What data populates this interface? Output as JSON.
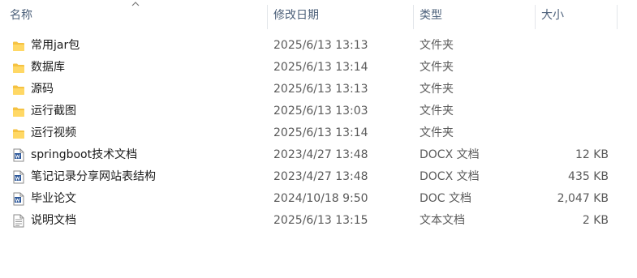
{
  "columns": {
    "name": "名称",
    "date": "修改日期",
    "type": "类型",
    "size": "大小"
  },
  "colors": {
    "header_text": "#4c607a",
    "folder": "#f5c242",
    "word_icon": "#2b579a"
  },
  "files": [
    {
      "name": "常用jar包",
      "date": "2025/6/13 13:13",
      "type": "文件夹",
      "size": "",
      "icon": "folder-icon"
    },
    {
      "name": "数据库",
      "date": "2025/6/13 13:14",
      "type": "文件夹",
      "size": "",
      "icon": "folder-icon"
    },
    {
      "name": "源码",
      "date": "2025/6/13 13:13",
      "type": "文件夹",
      "size": "",
      "icon": "folder-icon"
    },
    {
      "name": "运行截图",
      "date": "2025/6/13 13:03",
      "type": "文件夹",
      "size": "",
      "icon": "folder-icon"
    },
    {
      "name": "运行视频",
      "date": "2025/6/13 13:14",
      "type": "文件夹",
      "size": "",
      "icon": "folder-icon"
    },
    {
      "name": "springboot技术文档",
      "date": "2023/4/27 13:48",
      "type": "DOCX 文档",
      "size": "12 KB",
      "icon": "word-doc-icon"
    },
    {
      "name": "笔记记录分享网站表结构",
      "date": "2023/4/27 13:48",
      "type": "DOCX 文档",
      "size": "435 KB",
      "icon": "word-doc-icon"
    },
    {
      "name": "毕业论文",
      "date": "2024/10/18 9:50",
      "type": "DOC 文档",
      "size": "2,047 KB",
      "icon": "word-doc-icon"
    },
    {
      "name": "说明文档",
      "date": "2025/6/13 13:15",
      "type": "文本文档",
      "size": "2 KB",
      "icon": "text-doc-icon"
    }
  ]
}
